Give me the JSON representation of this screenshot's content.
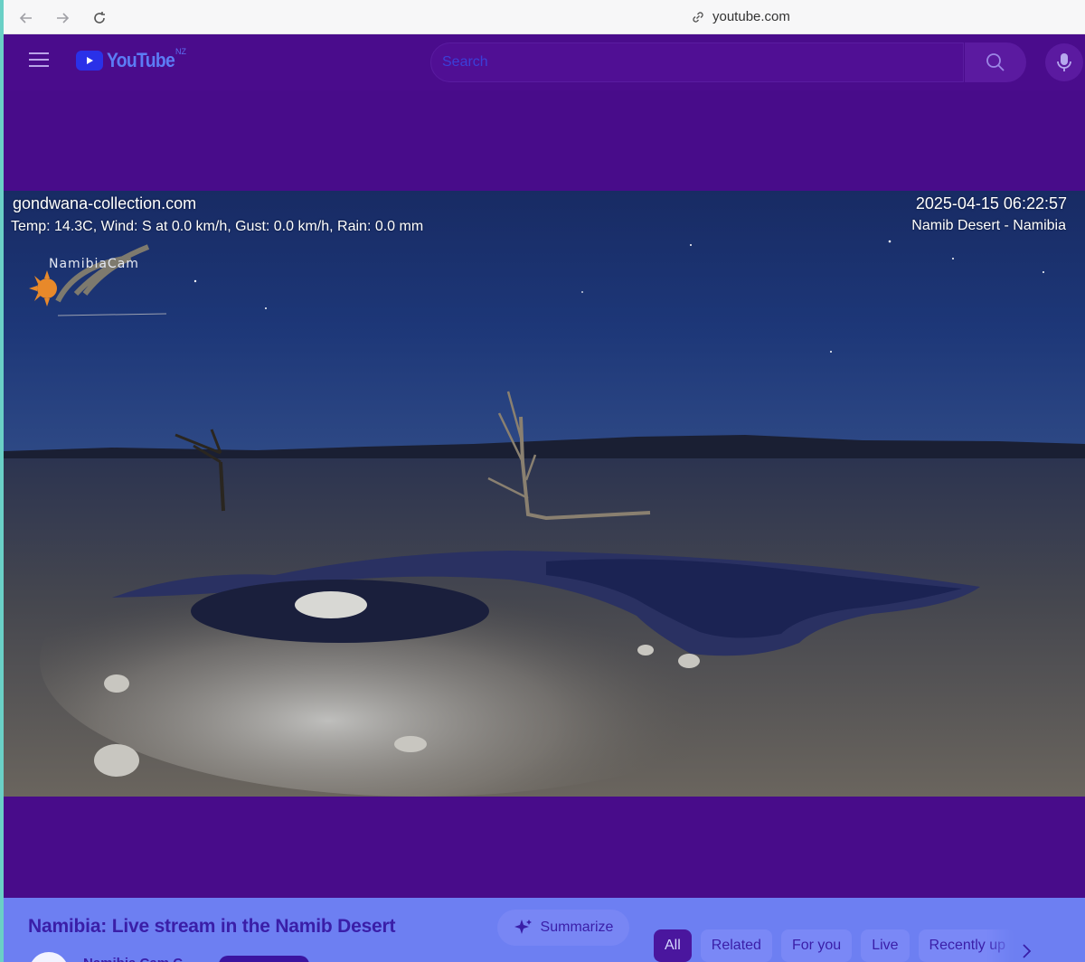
{
  "browser": {
    "url": "youtube.com"
  },
  "masthead": {
    "logo_text": "YouTube",
    "country_code": "NZ",
    "search_placeholder": "Search"
  },
  "video": {
    "overlay_site": "gondwana-collection.com",
    "overlay_weather": "Temp: 14.3C, Wind: S at 0.0 km/h, Gust: 0.0 km/h, Rain: 0.0 mm",
    "overlay_timestamp": "2025-04-15 06:22:57",
    "overlay_location": "Namib Desert - Namibia",
    "cam_logo_text": "NamibiaCam"
  },
  "below_video": {
    "title": "Namibia: Live stream in the Namib Desert",
    "summarize_label": "Summarize",
    "channel_name": "Namibia Cam C..."
  },
  "chips": [
    {
      "label": "All",
      "active": true
    },
    {
      "label": "Related",
      "active": false
    },
    {
      "label": "For you",
      "active": false
    },
    {
      "label": "Live",
      "active": false
    },
    {
      "label": "Recently up",
      "active": false
    }
  ],
  "colors": {
    "masthead_bg": "#4a0c8c",
    "page_bg": "#480c8a",
    "below_bg": "#6d7ff2",
    "title_color": "#3a1ea8"
  }
}
